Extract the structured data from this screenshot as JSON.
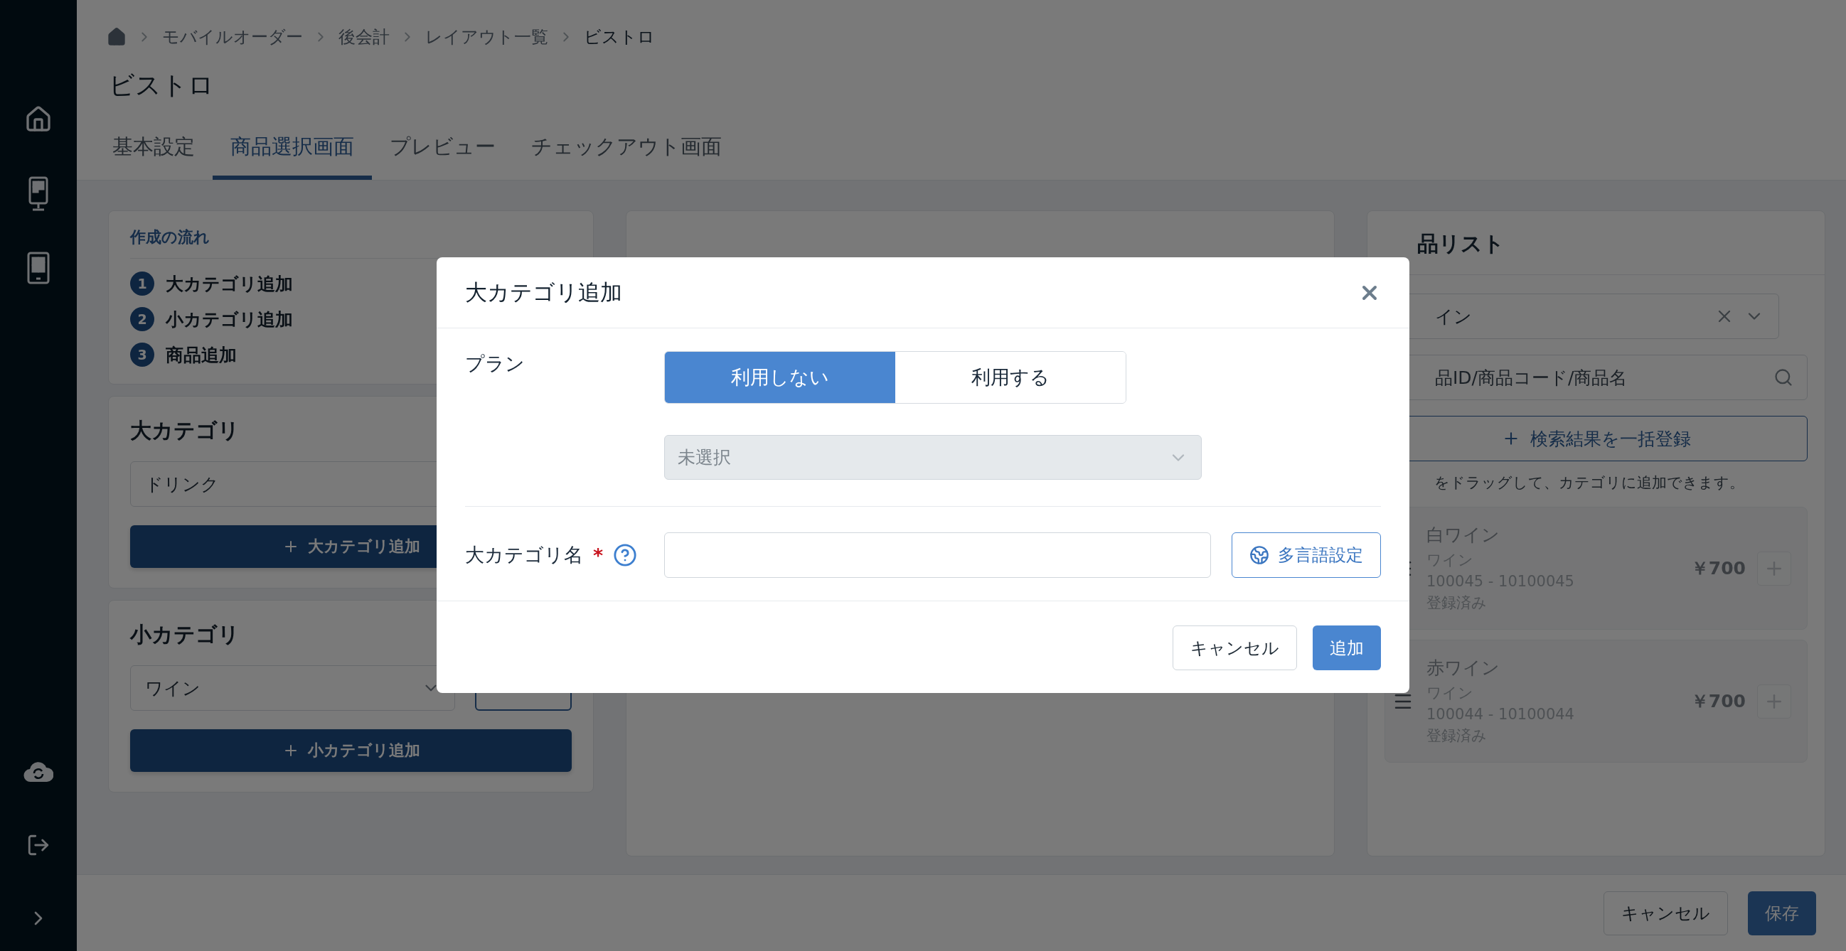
{
  "breadcrumb": [
    "モバイルオーダー",
    "後会計",
    "レイアウト一覧",
    "ビストロ"
  ],
  "page_title": "ビストロ",
  "tabs": [
    {
      "label": "基本設定",
      "selected": false
    },
    {
      "label": "商品選択画面",
      "selected": true
    },
    {
      "label": "プレビュー",
      "selected": false
    },
    {
      "label": "チェックアウト画面",
      "selected": false
    }
  ],
  "flow": {
    "title": "作成の流れ",
    "steps": [
      {
        "number": "1",
        "label": "大カテゴリ追加"
      },
      {
        "number": "2",
        "label": "小カテゴリ追加"
      },
      {
        "number": "3",
        "label": "商品追加"
      }
    ]
  },
  "major_category": {
    "title": "大カテゴリ",
    "value": "ドリンク",
    "add_button": "大カテゴリ追加"
  },
  "minor_category": {
    "title": "小カテゴリ",
    "value": "ワイン",
    "add_button": "小カテゴリ追加"
  },
  "product_list": {
    "title": "品リスト",
    "category_filter": "イン",
    "search_placeholder": "品ID/商品コード/商品名",
    "bulk_button": "検索結果を一括登録",
    "hint": "をドラッグして、カテゴリに追加できます。",
    "items": [
      {
        "name": "白ワイン",
        "category": "ワイン",
        "code": "100045 - 10100045",
        "status": "登録済み",
        "price": "￥700"
      },
      {
        "name": "赤ワイン",
        "category": "ワイン",
        "code": "100044 - 10100044",
        "status": "登録済み",
        "price": "￥700"
      }
    ]
  },
  "footer": {
    "cancel": "キャンセル",
    "save": "保存"
  },
  "dialog": {
    "title": "大カテゴリ追加",
    "plan_label": "プラン",
    "plan_options": [
      {
        "label": "利用しない",
        "selected": true
      },
      {
        "label": "利用する",
        "selected": false
      }
    ],
    "plan_select": {
      "value": "未選択",
      "disabled": true
    },
    "name_label": "大カテゴリ名",
    "required_mark": "*",
    "multilang_button": "多言語設定",
    "cancel": "キャンセル",
    "submit": "追加"
  }
}
